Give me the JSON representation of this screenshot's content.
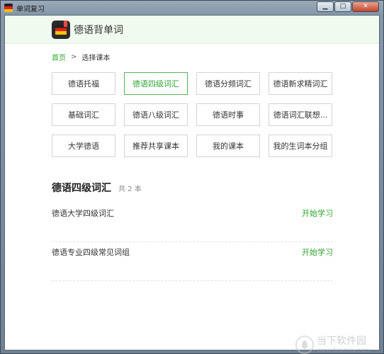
{
  "window": {
    "title": "单词复习",
    "buttons": {
      "minimize": "▁",
      "maximize": "□",
      "close": "✕"
    }
  },
  "app": {
    "title": "德语背单词",
    "logo_icon": "german-book-icon"
  },
  "breadcrumb": {
    "home": "首页",
    "separator": ">",
    "current": "选择课本"
  },
  "courses": [
    {
      "label": "德语托福",
      "active": false
    },
    {
      "label": "德语四级词汇",
      "active": true
    },
    {
      "label": "德语分频词汇",
      "active": false
    },
    {
      "label": "德语新求精词汇",
      "active": false
    },
    {
      "label": "基础词汇",
      "active": false
    },
    {
      "label": "德语八级词汇",
      "active": false
    },
    {
      "label": "德语时事",
      "active": false
    },
    {
      "label": "德语词汇联想...",
      "active": false
    },
    {
      "label": "大学德语",
      "active": false
    },
    {
      "label": "推荐共享课本",
      "active": false
    },
    {
      "label": "我的课本",
      "active": false
    },
    {
      "label": "我的生词本分组",
      "active": false
    }
  ],
  "section": {
    "title": "德语四级词汇",
    "count": "共 2 本"
  },
  "books": [
    {
      "name": "德语大学四级词汇",
      "action": "开始学习"
    },
    {
      "name": "德语专业四级常见词组",
      "action": "开始学习"
    }
  ],
  "watermark": {
    "main": "当下软件园",
    "sub": "www.downxia.com"
  },
  "colors": {
    "accent": "#2ea52e",
    "header_bg": "#f1faee"
  }
}
